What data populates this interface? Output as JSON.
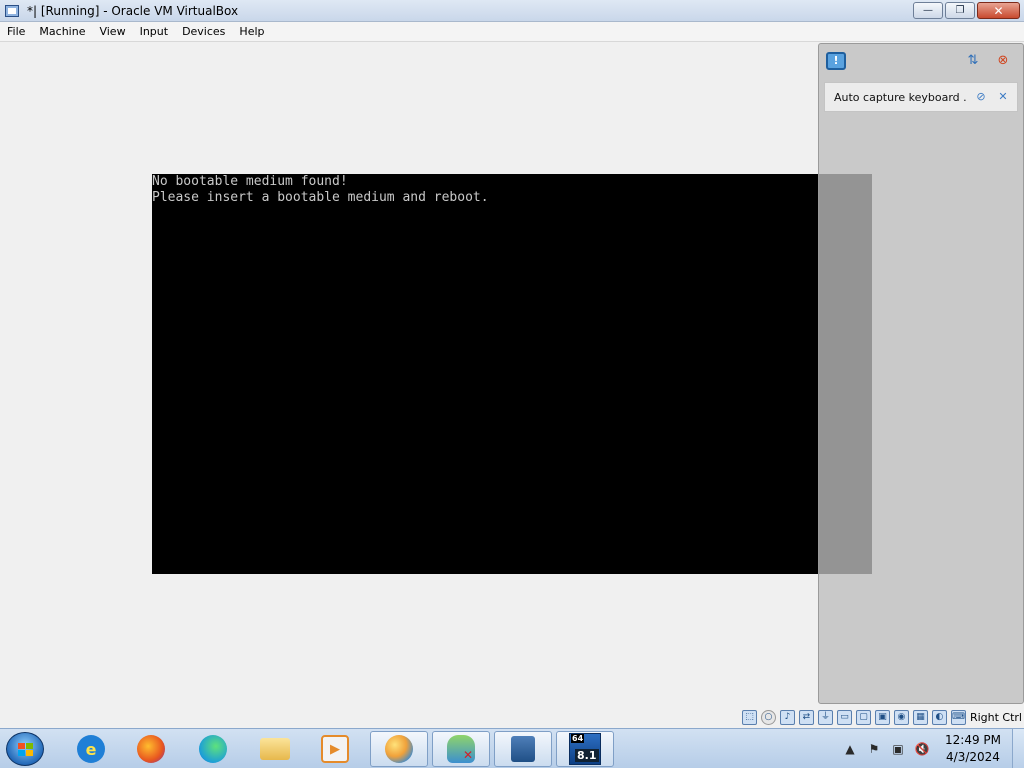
{
  "window": {
    "title": "*| [Running] - Oracle VM VirtualBox",
    "controls": {
      "minimize": "—",
      "restore": "❐",
      "close": "✕"
    }
  },
  "menu": [
    "File",
    "Machine",
    "View",
    "Input",
    "Devices",
    "Help"
  ],
  "vm_screen": {
    "lines": [
      "No bootable medium found!",
      "Please insert a bootable medium and reboot."
    ]
  },
  "notification_panel": {
    "header_icon": "notification-icon",
    "tools": [
      "sort-icon",
      "close-all-icon"
    ],
    "card": {
      "text": "Auto capture keyboard ..."
    }
  },
  "status_bar": {
    "host_key": "Right Ctrl",
    "icons": [
      "hard-disk-icon",
      "optical-drive-icon",
      "audio-icon",
      "network-icon",
      "usb-icon",
      "shared-folders-icon",
      "display-icon",
      "video-capture-icon",
      "recording-icon",
      "cpu-icon",
      "mouse-integration-icon",
      "keyboard-icon"
    ]
  },
  "taskbar": {
    "apps": [
      {
        "name": "start-icon"
      },
      {
        "name": "internet-explorer-icon"
      },
      {
        "name": "firefox-icon"
      },
      {
        "name": "edge-icon"
      },
      {
        "name": "file-explorer-icon"
      },
      {
        "name": "media-player-icon"
      },
      {
        "name": "paint-icon"
      },
      {
        "name": "network-user-icon"
      },
      {
        "name": "virtualbox-icon"
      },
      {
        "name": "windows-8-1-vm-icon",
        "badge_top": "64",
        "badge": "8.1"
      }
    ],
    "clock": {
      "time": "12:49 PM",
      "date": "4/3/2024"
    }
  },
  "colors": {
    "vm_background": "#000000",
    "vm_text": "#c8c8c8",
    "panel_background": "#bebebe",
    "taskbar": "#c5d8ee"
  }
}
